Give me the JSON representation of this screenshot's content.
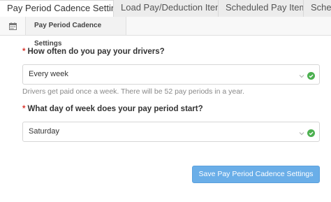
{
  "tabs": [
    {
      "label": "Pay Period Cadence Setting",
      "active": true
    },
    {
      "label": "Load Pay/Deduction Items",
      "active": false
    },
    {
      "label": "Scheduled Pay Items",
      "active": false
    },
    {
      "label": "Schedu",
      "active": false
    }
  ],
  "subheader": {
    "icon": "calendar-icon",
    "title": "Pay Period Cadence Settings"
  },
  "form": {
    "required_marker": "*",
    "frequency": {
      "label": "How often do you pay your drivers?",
      "value": "Every week",
      "help": "Drivers get paid once a week. There will be 52 pay periods in a year."
    },
    "start_day": {
      "label": "What day of week does your pay period start?",
      "value": "Saturday"
    },
    "save_label": "Save Pay Period Cadence Settings"
  },
  "colors": {
    "accent": "#6aaee8",
    "required": "#d9362e",
    "valid": "#4cb050"
  }
}
